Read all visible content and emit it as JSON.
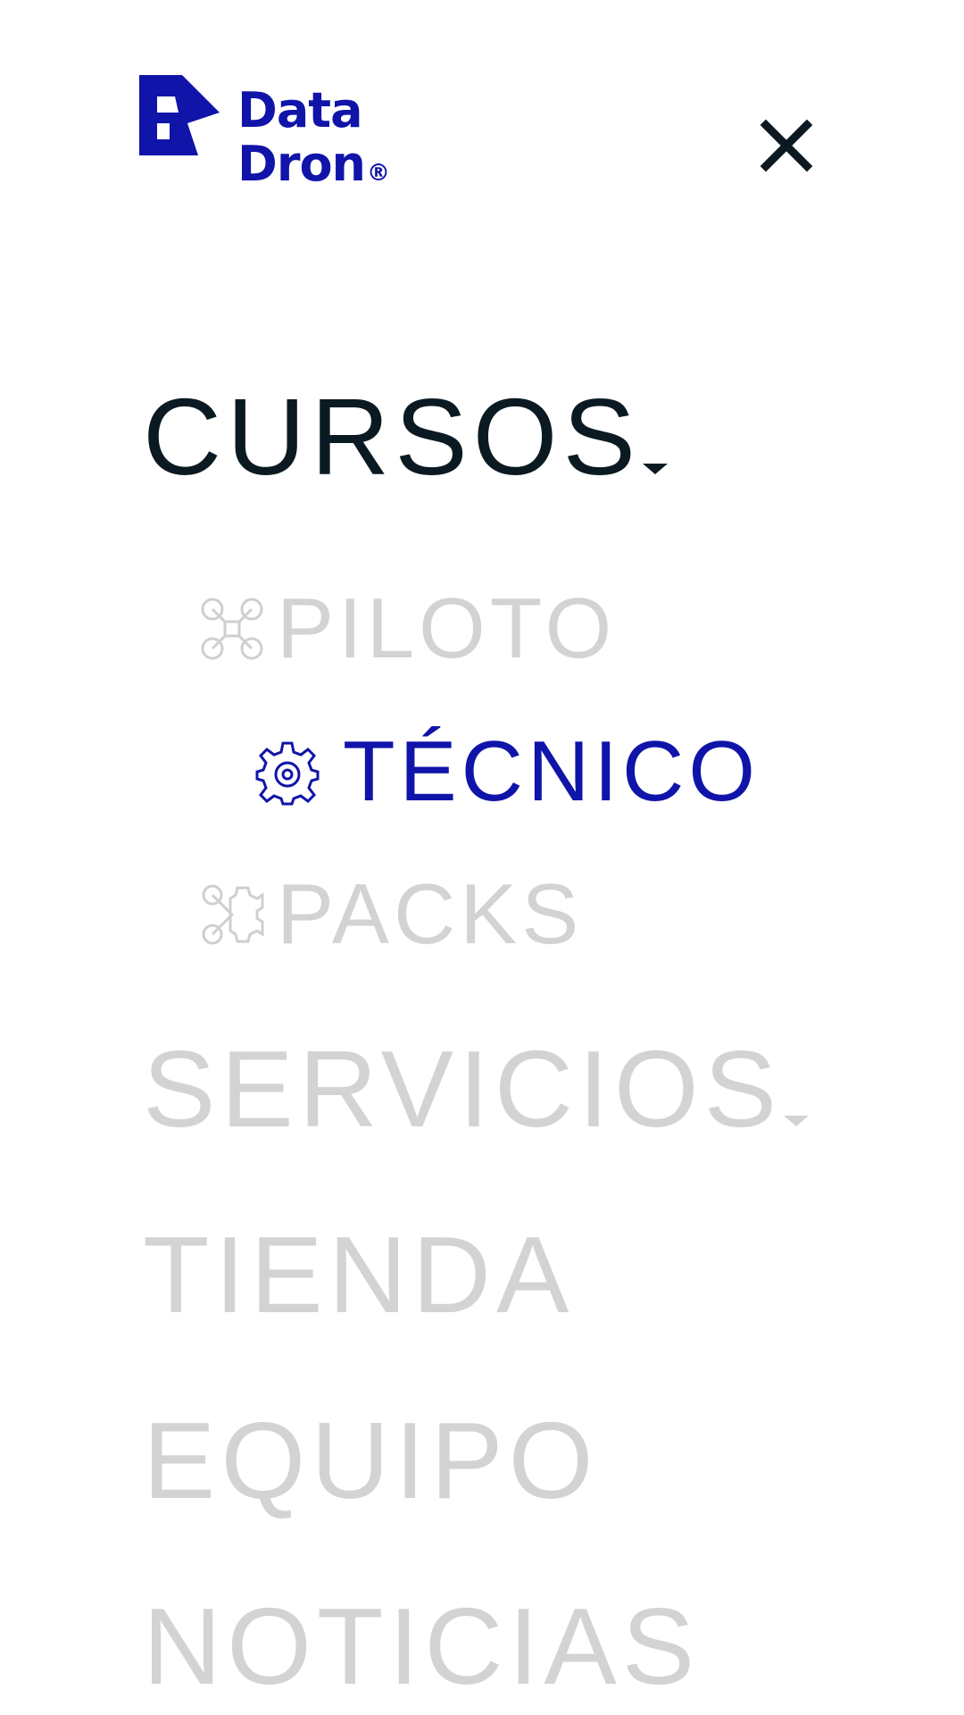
{
  "brand": {
    "name_line1": "Data",
    "name_line2": "Dron",
    "registered_mark": "®",
    "color": "#1014a9"
  },
  "header": {
    "close_icon": "close-icon"
  },
  "menu": {
    "items": [
      {
        "label": "CURSOS",
        "state": "expanded",
        "has_dropdown": true,
        "submenu": [
          {
            "label": "PILOTO",
            "icon": "drone-icon",
            "active": false
          },
          {
            "label": "TÉCNICO",
            "icon": "gear-icon",
            "active": true
          },
          {
            "label": "PACKS",
            "icon": "drone-gear-icon",
            "active": false
          }
        ]
      },
      {
        "label": "SERVICIOS",
        "has_dropdown": true
      },
      {
        "label": "TIENDA",
        "has_dropdown": false
      },
      {
        "label": "EQUIPO",
        "has_dropdown": false
      },
      {
        "label": "NOTICIAS",
        "has_dropdown": false
      }
    ]
  },
  "colors": {
    "text_dark": "#0b1a22",
    "text_inactive": "#d3d3d3",
    "accent": "#1014a9"
  }
}
